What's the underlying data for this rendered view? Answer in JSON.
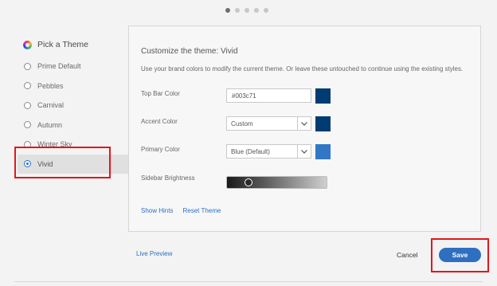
{
  "pager": {
    "count": 5,
    "active_index": 0
  },
  "sidebar": {
    "title": "Pick a Theme",
    "items": [
      {
        "label": "Prime Default",
        "selected": false
      },
      {
        "label": "Pebbles",
        "selected": false
      },
      {
        "label": "Carnival",
        "selected": false
      },
      {
        "label": "Autumn",
        "selected": false
      },
      {
        "label": "Winter Sky",
        "selected": false
      },
      {
        "label": "Vivid",
        "selected": true
      }
    ]
  },
  "panel": {
    "title": "Customize the theme: Vivid",
    "description": "Use your brand colors to modify the current theme. Or leave these untouched to continue using the existing styles.",
    "top_bar": {
      "label": "Top Bar Color",
      "value": "#003c71",
      "swatch": "#003c71"
    },
    "accent": {
      "label": "Accent Color",
      "value": "Custom",
      "swatch": "#003c71"
    },
    "primary": {
      "label": "Primary Color",
      "value": "Blue (Default)",
      "swatch": "#3277c5"
    },
    "sidebar_brightness": {
      "label": "Sidebar Brightness",
      "value": 0.19
    },
    "show_hints": "Show Hints",
    "reset_theme": "Reset Theme"
  },
  "footer": {
    "live_preview": "Live Preview",
    "cancel": "Cancel",
    "save": "Save"
  },
  "colors": {
    "accent_blue": "#2f6fc0",
    "annotation_red": "#e3161b"
  }
}
